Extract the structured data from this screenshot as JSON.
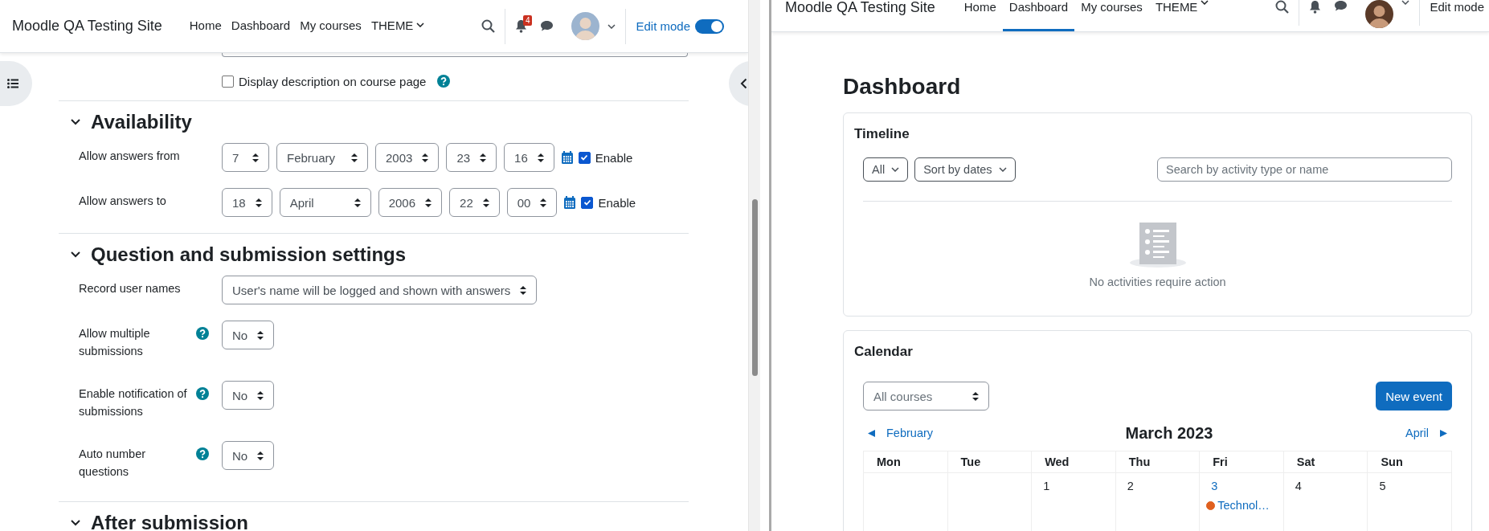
{
  "left_window": {
    "navbar": {
      "site_name": "Moodle QA Testing Site",
      "nav": [
        {
          "label": "Home",
          "selected": false,
          "menu": false
        },
        {
          "label": "Dashboard",
          "selected": false,
          "menu": false
        },
        {
          "label": "My courses",
          "selected": false,
          "menu": false
        },
        {
          "label": "THEME",
          "selected": false,
          "menu": true
        }
      ],
      "notification_count": "4",
      "edit_mode": "Edit mode",
      "edit_toggle": {
        "on": true
      }
    },
    "form": {
      "description_option": {
        "label": "Display description on course page",
        "checked": false
      },
      "sections": [
        {
          "title": "Availability",
          "expanded": true,
          "rows": [
            {
              "kind": "datetime",
              "label": "Allow answers from",
              "help": false,
              "fields": [
                "7",
                "February",
                "2003",
                "23",
                "16"
              ],
              "enable": {
                "label": "Enable",
                "checked": true
              }
            },
            {
              "kind": "datetime",
              "label": "Allow answers to",
              "help": false,
              "fields": [
                "18",
                "April",
                "2006",
                "22",
                "00"
              ],
              "enable": {
                "label": "Enable",
                "checked": true
              }
            }
          ]
        },
        {
          "title": "Question and submission settings",
          "expanded": true,
          "rows": [
            {
              "kind": "select",
              "label": "Record user names",
              "help": false,
              "value": "User's name will be logged and shown with answers"
            },
            {
              "kind": "select",
              "label": "Allow multiple submissions",
              "help": true,
              "value": "No"
            },
            {
              "kind": "select",
              "label": "Enable notification of submissions",
              "help": true,
              "value": "No"
            },
            {
              "kind": "select",
              "label": "Auto number questions",
              "help": true,
              "value": "No"
            }
          ]
        },
        {
          "title": "After submission",
          "expanded": true
        }
      ]
    }
  },
  "right_window": {
    "navbar": {
      "site_name": "Moodle QA Testing Site",
      "nav": [
        {
          "label": "Home",
          "selected": false,
          "menu": false
        },
        {
          "label": "Dashboard",
          "selected": true,
          "menu": false
        },
        {
          "label": "My courses",
          "selected": false,
          "menu": false
        },
        {
          "label": "THEME",
          "selected": false,
          "menu": true
        }
      ],
      "edit_mode": "Edit mode"
    },
    "page_title": "Dashboard",
    "timeline": {
      "title": "Timeline",
      "filter": "All",
      "sort": "Sort by dates",
      "search": {
        "placeholder": "Search by activity type or name"
      },
      "empty_message": "No activities require action"
    },
    "calendar": {
      "title": "Calendar",
      "course_filter": "All courses",
      "new_event": "New event",
      "prev_month": "February",
      "month": "March 2023",
      "next_month": "April",
      "weekdays": [
        "Mon",
        "Tue",
        "Wed",
        "Thu",
        "Fri",
        "Sat",
        "Sun"
      ],
      "week": [
        {
          "kind": "blank"
        },
        {
          "kind": "blank"
        },
        {
          "kind": "day",
          "day": "1"
        },
        {
          "kind": "day",
          "day": "2"
        },
        {
          "kind": "day",
          "day": "3",
          "events": [
            {
              "name": "Technol…",
              "color": "#e0601f"
            }
          ]
        },
        {
          "kind": "day",
          "day": "4"
        },
        {
          "kind": "day",
          "day": "5"
        }
      ]
    }
  }
}
